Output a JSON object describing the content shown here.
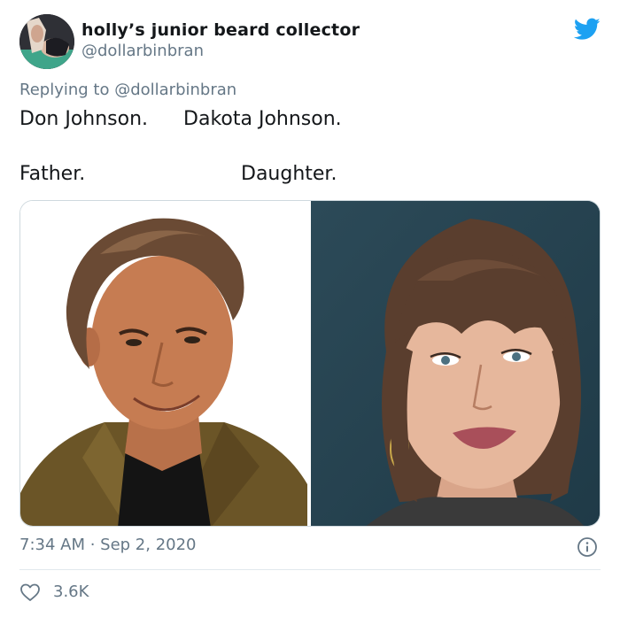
{
  "author": {
    "display_name": "holly’s junior beard collector",
    "handle": "@dollarbinbran"
  },
  "reply": {
    "prefix": "Replying to ",
    "mention": "@dollarbinbran"
  },
  "text": {
    "name_left": "Don Johnson.",
    "name_right": "Dakota Johnson.",
    "role_left": "Father.",
    "role_right": "Daughter."
  },
  "meta": {
    "timestamp": "7:34 AM · Sep 2, 2020"
  },
  "stats": {
    "likes": "3.6K"
  },
  "icons": {
    "brand": "twitter-bird-icon",
    "info": "info-icon",
    "like": "heart-icon"
  },
  "colors": {
    "brand": "#1da1f2",
    "secondary_text": "#657786",
    "primary_text": "#14171a",
    "border": "#cfd9de"
  }
}
